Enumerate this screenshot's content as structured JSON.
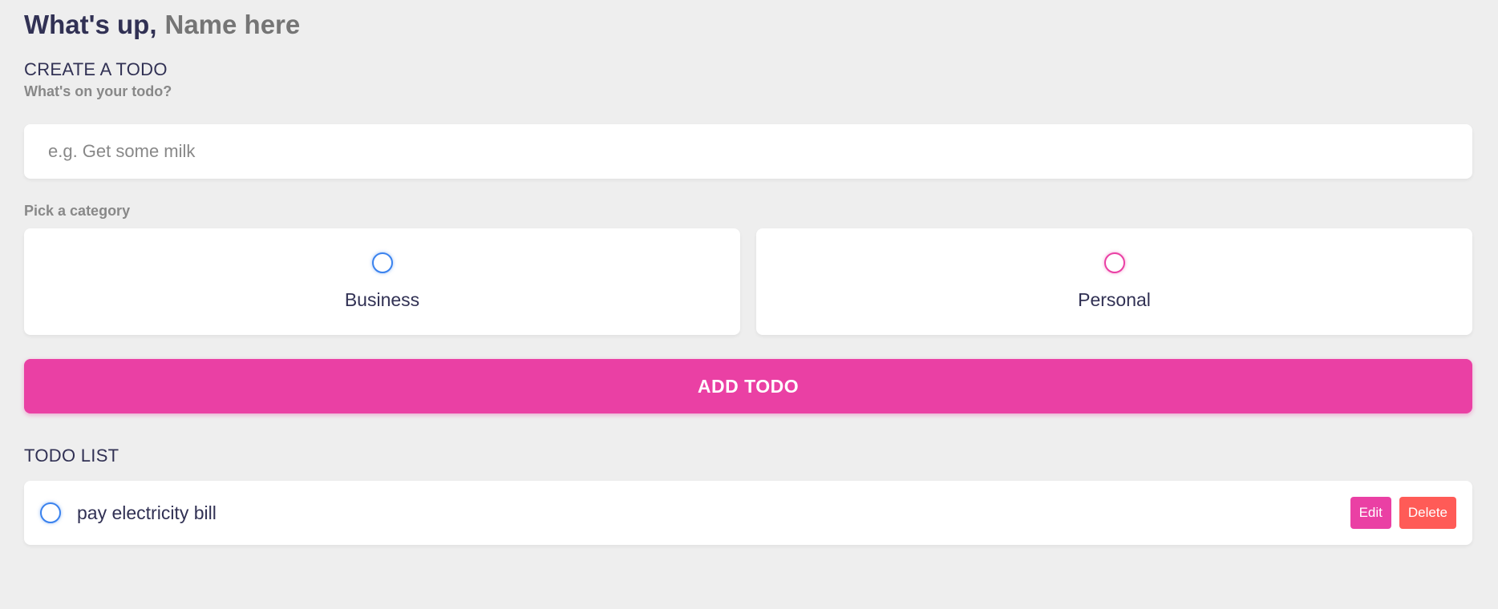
{
  "greeting": {
    "prefix": "What's up,",
    "name_placeholder": "Name here"
  },
  "create_section": {
    "title": "CREATE A TODO",
    "input_label": "What's on your todo?",
    "input_placeholder": "e.g. Get some milk",
    "input_value": "",
    "category_label": "Pick a category",
    "categories": [
      {
        "label": "Business",
        "bubble_color": "#3a82ee",
        "selected": false
      },
      {
        "label": "Personal",
        "bubble_color": "#ea40a4",
        "selected": false
      }
    ],
    "add_button_label": "ADD TODO"
  },
  "todo_section": {
    "title": "TODO LIST",
    "items": [
      {
        "text": "pay electricity bill",
        "category": "Business",
        "done": false,
        "edit_label": "Edit",
        "delete_label": "Delete"
      }
    ]
  },
  "colors": {
    "background": "#eeeeee",
    "text_dark": "#313154",
    "muted": "#888888",
    "business": "#3a82ee",
    "personal": "#ea40a4",
    "danger": "#ff5b57"
  }
}
